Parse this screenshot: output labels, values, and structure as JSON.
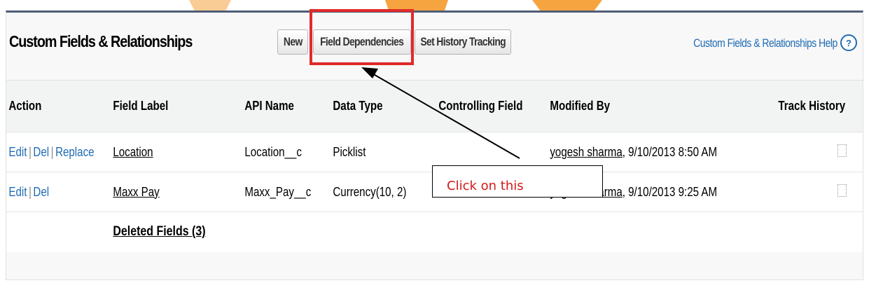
{
  "section": {
    "title": "Custom Fields & Relationships",
    "buttons": {
      "new": "New",
      "field_dependencies": "Field Dependencies",
      "set_history_tracking": "Set History Tracking"
    },
    "help_link": "Custom Fields & Relationships Help",
    "help_icon": "?"
  },
  "table": {
    "headers": [
      "Action",
      "Field Label",
      "API Name",
      "Data Type",
      "Controlling Field",
      "Modified By",
      "Track History"
    ],
    "rows": [
      {
        "actions": [
          "Edit",
          "Del",
          "Replace"
        ],
        "field_label": "Location",
        "api_name": "Location__c",
        "data_type": "Picklist",
        "controlling_field": "",
        "modified_by_user": "yogesh sharma",
        "modified_by_time": ", 9/10/2013 8:50 AM"
      },
      {
        "actions": [
          "Edit",
          "Del"
        ],
        "field_label": "Maxx Pay",
        "api_name": "Maxx_Pay__c",
        "data_type": "Currency(10, 2)",
        "controlling_field": "",
        "modified_by_user": "yogesh sharma",
        "modified_by_time": ", 9/10/2013 9:25 AM"
      }
    ],
    "deleted_fields": "Deleted Fields (3)"
  },
  "annotation": {
    "text": "Click on this",
    "color": "#d41818"
  },
  "colors": {
    "link": "#1f6bb3",
    "highlight": "#e22a2a",
    "header_bg": "#f2f3f3"
  }
}
